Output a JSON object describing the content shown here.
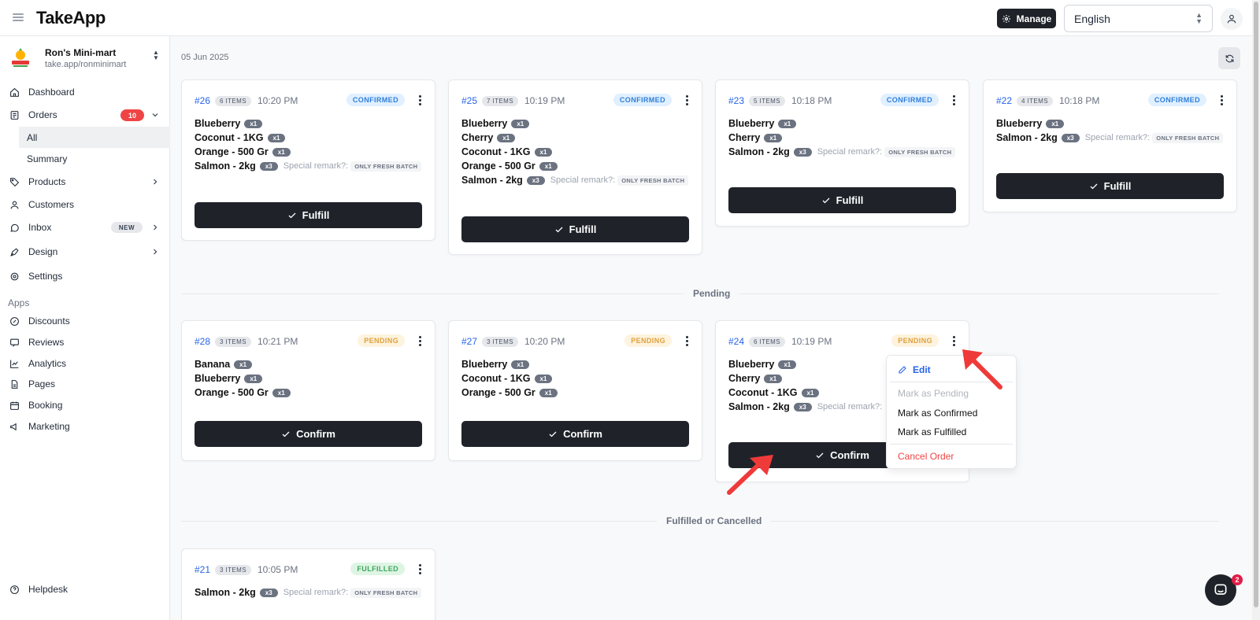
{
  "app": {
    "brand": "TakeApp",
    "manage_label": "Manage",
    "language": "English"
  },
  "store": {
    "name": "Ron's Mini-mart",
    "url": "take.app/ronminimart"
  },
  "nav": {
    "dashboard": "Dashboard",
    "orders": "Orders",
    "orders_count": "10",
    "orders_all": "All",
    "orders_summary": "Summary",
    "products": "Products",
    "customers": "Customers",
    "inbox": "Inbox",
    "inbox_badge": "NEW",
    "design": "Design",
    "settings": "Settings",
    "apps_label": "Apps",
    "discounts": "Discounts",
    "reviews": "Reviews",
    "analytics": "Analytics",
    "pages": "Pages",
    "booking": "Booking",
    "marketing": "Marketing",
    "helpdesk": "Helpdesk"
  },
  "main": {
    "date": "05 Jun 2025",
    "pending_label": "Pending",
    "fulfilled_label": "Fulfilled or Cancelled",
    "remark_label": "Special remark?:",
    "remark_value": "ONLY FRESH BATCH",
    "fulfill_label": "Fulfill",
    "confirm_label": "Confirm"
  },
  "orders": {
    "o26": {
      "id": "#26",
      "items": "6 ITEMS",
      "time": "10:20 PM",
      "status": "CONFIRMED",
      "lines": [
        {
          "name": "Blueberry",
          "qty": "x1"
        },
        {
          "name": "Coconut - 1KG",
          "qty": "x1"
        },
        {
          "name": "Orange - 500 Gr",
          "qty": "x1"
        },
        {
          "name": "Salmon - 2kg",
          "qty": "x3"
        }
      ]
    },
    "o25": {
      "id": "#25",
      "items": "7 ITEMS",
      "time": "10:19 PM",
      "status": "CONFIRMED",
      "lines": [
        {
          "name": "Blueberry",
          "qty": "x1"
        },
        {
          "name": "Cherry",
          "qty": "x1"
        },
        {
          "name": "Coconut - 1KG",
          "qty": "x1"
        },
        {
          "name": "Orange - 500 Gr",
          "qty": "x1"
        },
        {
          "name": "Salmon - 2kg",
          "qty": "x3"
        }
      ]
    },
    "o23": {
      "id": "#23",
      "items": "5 ITEMS",
      "time": "10:18 PM",
      "status": "CONFIRMED",
      "lines": [
        {
          "name": "Blueberry",
          "qty": "x1"
        },
        {
          "name": "Cherry",
          "qty": "x1"
        },
        {
          "name": "Salmon - 2kg",
          "qty": "x3"
        }
      ]
    },
    "o22": {
      "id": "#22",
      "items": "4 ITEMS",
      "time": "10:18 PM",
      "status": "CONFIRMED",
      "lines": [
        {
          "name": "Blueberry",
          "qty": "x1"
        },
        {
          "name": "Salmon - 2kg",
          "qty": "x3"
        }
      ]
    },
    "o28": {
      "id": "#28",
      "items": "3 ITEMS",
      "time": "10:21 PM",
      "status": "PENDING",
      "lines": [
        {
          "name": "Banana",
          "qty": "x1"
        },
        {
          "name": "Blueberry",
          "qty": "x1"
        },
        {
          "name": "Orange - 500 Gr",
          "qty": "x1"
        }
      ]
    },
    "o27": {
      "id": "#27",
      "items": "3 ITEMS",
      "time": "10:20 PM",
      "status": "PENDING",
      "lines": [
        {
          "name": "Blueberry",
          "qty": "x1"
        },
        {
          "name": "Coconut - 1KG",
          "qty": "x1"
        },
        {
          "name": "Orange - 500 Gr",
          "qty": "x1"
        }
      ]
    },
    "o24": {
      "id": "#24",
      "items": "6 ITEMS",
      "time": "10:19 PM",
      "status": "PENDING",
      "lines": [
        {
          "name": "Blueberry",
          "qty": "x1"
        },
        {
          "name": "Cherry",
          "qty": "x1"
        },
        {
          "name": "Coconut - 1KG",
          "qty": "x1"
        },
        {
          "name": "Salmon - 2kg",
          "qty": "x3"
        }
      ]
    },
    "o21": {
      "id": "#21",
      "items": "3 ITEMS",
      "time": "10:05 PM",
      "status": "FULFILLED",
      "lines": [
        {
          "name": "Salmon - 2kg",
          "qty": "x3"
        }
      ]
    }
  },
  "menu": {
    "edit": "Edit",
    "mark_pending": "Mark as Pending",
    "mark_confirmed": "Mark as Confirmed",
    "mark_fulfilled": "Mark as Fulfilled",
    "cancel": "Cancel Order"
  },
  "chat": {
    "unread": "2"
  },
  "colors": {
    "accent": "#2563eb",
    "danger": "#ef4444",
    "button_dark": "#1f2329",
    "annotation_arrow": "#ef3a3a"
  }
}
